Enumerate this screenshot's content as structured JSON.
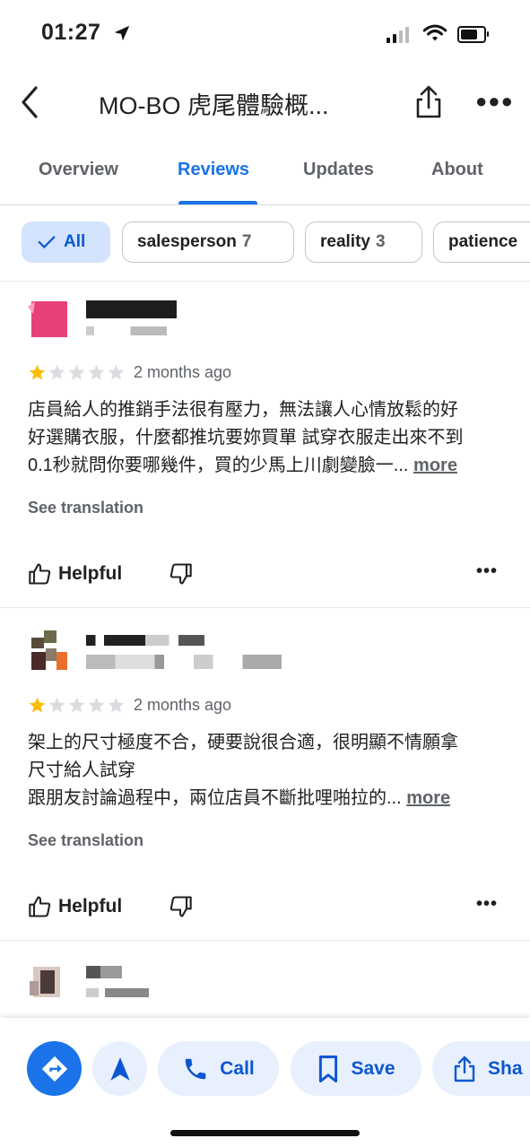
{
  "status_bar": {
    "time": "01:27"
  },
  "header": {
    "title": "MO-BO 虎尾體驗概..."
  },
  "tabs": [
    {
      "label": "Overview"
    },
    {
      "label": "Reviews"
    },
    {
      "label": "Updates"
    },
    {
      "label": "About"
    }
  ],
  "chips": [
    {
      "label": "All"
    },
    {
      "label": "salesperson",
      "count": "7"
    },
    {
      "label": "reality",
      "count": "3"
    },
    {
      "label": "patience"
    }
  ],
  "reviews": [
    {
      "rating": 1,
      "date": "2 months ago",
      "text_lines": [
        "店員給人的推銷手法很有壓力，無法讓人心情放鬆的好",
        "好選購衣服，什麼都推坑要妳買單 試穿衣服走出來不到",
        "0.1秒就問你要哪幾件，買的少馬上川劇變臉一..."
      ],
      "more": "more",
      "see_translation": "See translation",
      "helpful": "Helpful"
    },
    {
      "rating": 1,
      "date": "2 months ago",
      "text_lines": [
        "架上的尺寸極度不合，硬要說很合適，很明顯不情願拿",
        "尺寸給人試穿",
        "跟朋友討論過程中，兩位店員不斷批哩啪拉的..."
      ],
      "more": "more",
      "see_translation": "See translation",
      "helpful": "Helpful"
    }
  ],
  "actions": [
    {
      "label": "Call",
      "icon": "phone-icon"
    },
    {
      "label": "Save",
      "icon": "bookmark-icon"
    },
    {
      "label": "Sha",
      "icon": "share-icon"
    }
  ],
  "colors": {
    "accent": "#1a73e8",
    "star": "#fbbc04",
    "star_empty": "#dadce0"
  }
}
